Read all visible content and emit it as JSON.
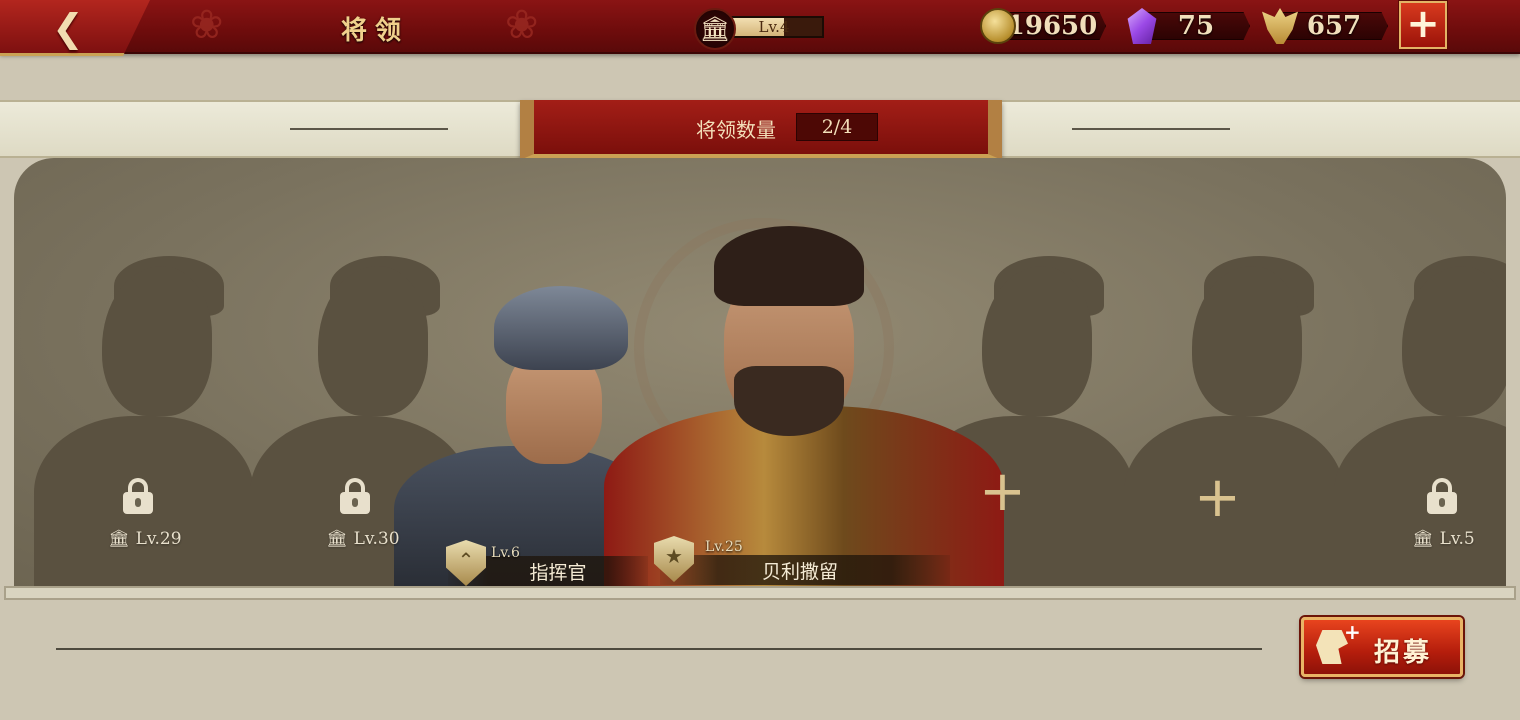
{
  "header": {
    "title": "将领",
    "back_icon": "back-chevron-icon",
    "level_label": "Lv.4",
    "level_progress": 0.6,
    "resources": [
      {
        "name": "coin",
        "icon": "coin-icon",
        "value": "19650"
      },
      {
        "name": "gem",
        "icon": "gem-icon",
        "value": "75"
      },
      {
        "name": "spqr",
        "icon": "eagle-icon",
        "value": "657"
      }
    ],
    "add_icon": "plus-icon"
  },
  "banner": {
    "label": "将领数量",
    "count": "2/4"
  },
  "slots": {
    "left1": {
      "state": "locked",
      "level": "Lv.29"
    },
    "left2": {
      "state": "locked",
      "level": "Lv.30"
    },
    "right1": {
      "state": "empty"
    },
    "right2": {
      "state": "empty"
    },
    "right3": {
      "state": "locked",
      "level": "Lv.5"
    }
  },
  "generals": [
    {
      "name": "指挥官",
      "level": "Lv.6",
      "rank_icon": "chevron-rank-icon"
    },
    {
      "name": "贝利撒留",
      "level": "Lv.25",
      "rank_icon": "star-rank-icon"
    }
  ],
  "recruit": {
    "label": "招募",
    "icon": "helmet-plus-icon"
  },
  "colors": {
    "topbar": "#7a1010",
    "gold": "#caa154",
    "stage": "#7a725e",
    "recruit": "#c8270f"
  }
}
